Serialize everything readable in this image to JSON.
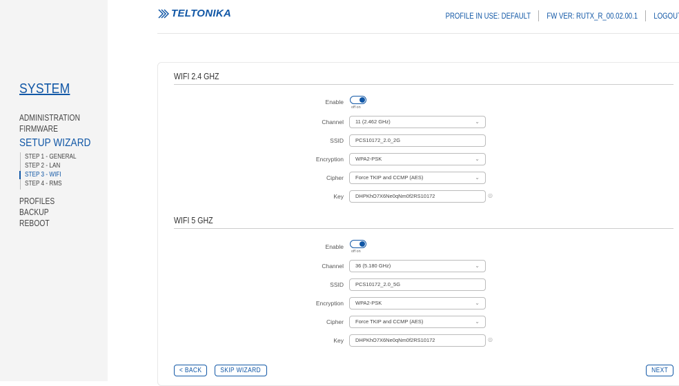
{
  "sidebar": {
    "title": "SYSTEM",
    "items_top": [
      "ADMINISTRATION",
      "FIRMWARE"
    ],
    "active_item": "SETUP WIZARD",
    "steps": [
      "STEP 1 - GENERAL",
      "STEP 2 - LAN",
      "STEP 3 - WIFI",
      "STEP 4 - RMS"
    ],
    "items_bottom": [
      "PROFILES",
      "BACKUP",
      "REBOOT"
    ]
  },
  "header": {
    "logo": "TELTONIKA",
    "profile": "PROFILE IN USE: DEFAULT",
    "fw": "FW VER: RUTX_R_00.02.00.1",
    "logout": "LOGOUT"
  },
  "colors": {
    "accent": "#1157a6"
  },
  "wifi24": {
    "title": "WIFI 2.4 GHZ",
    "enable_label": "Enable",
    "toggle_text": "off on",
    "channel_label": "Channel",
    "channel_value": "11 (2.462 GHz)",
    "ssid_label": "SSID",
    "ssid_value": "PCS10172_2.0_2G",
    "encryption_label": "Encryption",
    "encryption_value": "WPA2-PSK",
    "cipher_label": "Cipher",
    "cipher_value": "Force TKIP and CCMP (AES)",
    "key_label": "Key",
    "key_value": "DHPKhO7X6Ne0qNm0f2RS10172"
  },
  "wifi5": {
    "title": "WIFI 5 GHZ",
    "enable_label": "Enable",
    "toggle_text": "off on",
    "channel_label": "Channel",
    "channel_value": "36 (5.180 GHz)",
    "ssid_label": "SSID",
    "ssid_value": "PCS10172_2.0_5G",
    "encryption_label": "Encryption",
    "encryption_value": "WPA2-PSK",
    "cipher_label": "Cipher",
    "cipher_value": "Force TKIP and CCMP (AES)",
    "key_label": "Key",
    "key_value": "DHPKhO7X6Ne0qNm0f2RS10172"
  },
  "buttons": {
    "back": "< BACK",
    "skip": "SKIP WIZARD",
    "next": "NEXT"
  }
}
